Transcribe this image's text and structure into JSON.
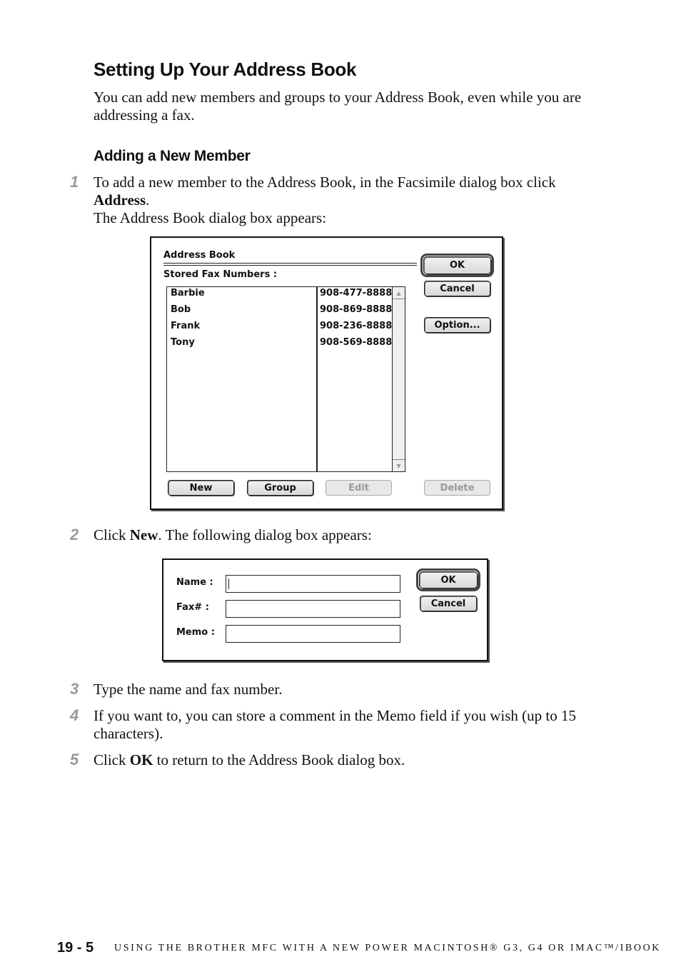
{
  "heading": "Setting Up Your Address Book",
  "intro": "You can add new members and groups to your Address Book, even while you are addressing a fax.",
  "subheading": "Adding a New Member",
  "steps": [
    {
      "num": "1",
      "text_before": "To add a new member to the Address Book, in the Facsimile dialog box click ",
      "bold": "Address",
      "text_after": ".",
      "line2": "The Address Book dialog box appears:"
    },
    {
      "num": "2",
      "text_before": "Click ",
      "bold": "New",
      "text_after": ". The following dialog box appears:"
    },
    {
      "num": "3",
      "text": "Type the name and fax number."
    },
    {
      "num": "4",
      "text": "If you want to, you can store a comment in the Memo field if you wish (up to 15 characters)."
    },
    {
      "num": "5",
      "text_before": "Click ",
      "bold": "OK",
      "text_after": " to return to the Address Book dialog box."
    }
  ],
  "address_book_dialog": {
    "title": "Address Book",
    "list_label": "Stored Fax Numbers :",
    "entries": [
      {
        "name": "Barbie",
        "fax": "908-477-8888"
      },
      {
        "name": "Bob",
        "fax": "908-869-8888"
      },
      {
        "name": "Frank",
        "fax": "908-236-8888"
      },
      {
        "name": "Tony",
        "fax": "908-569-8888"
      }
    ],
    "buttons": {
      "ok": "OK",
      "cancel": "Cancel",
      "option": "Option...",
      "new": "New",
      "group": "Group",
      "edit": "Edit",
      "delete": "Delete"
    }
  },
  "new_member_dialog": {
    "fields": [
      {
        "label": "Name :",
        "value": ""
      },
      {
        "label": "Fax# :",
        "value": ""
      },
      {
        "label": "Memo :",
        "value": ""
      }
    ],
    "buttons": {
      "ok": "OK",
      "cancel": "Cancel"
    }
  },
  "footer": {
    "page": "19 - 5",
    "text": "USING THE BROTHER MFC WITH A NEW POWER MACINTOSH® G3, G4 OR IMAC™/IBOOK"
  }
}
